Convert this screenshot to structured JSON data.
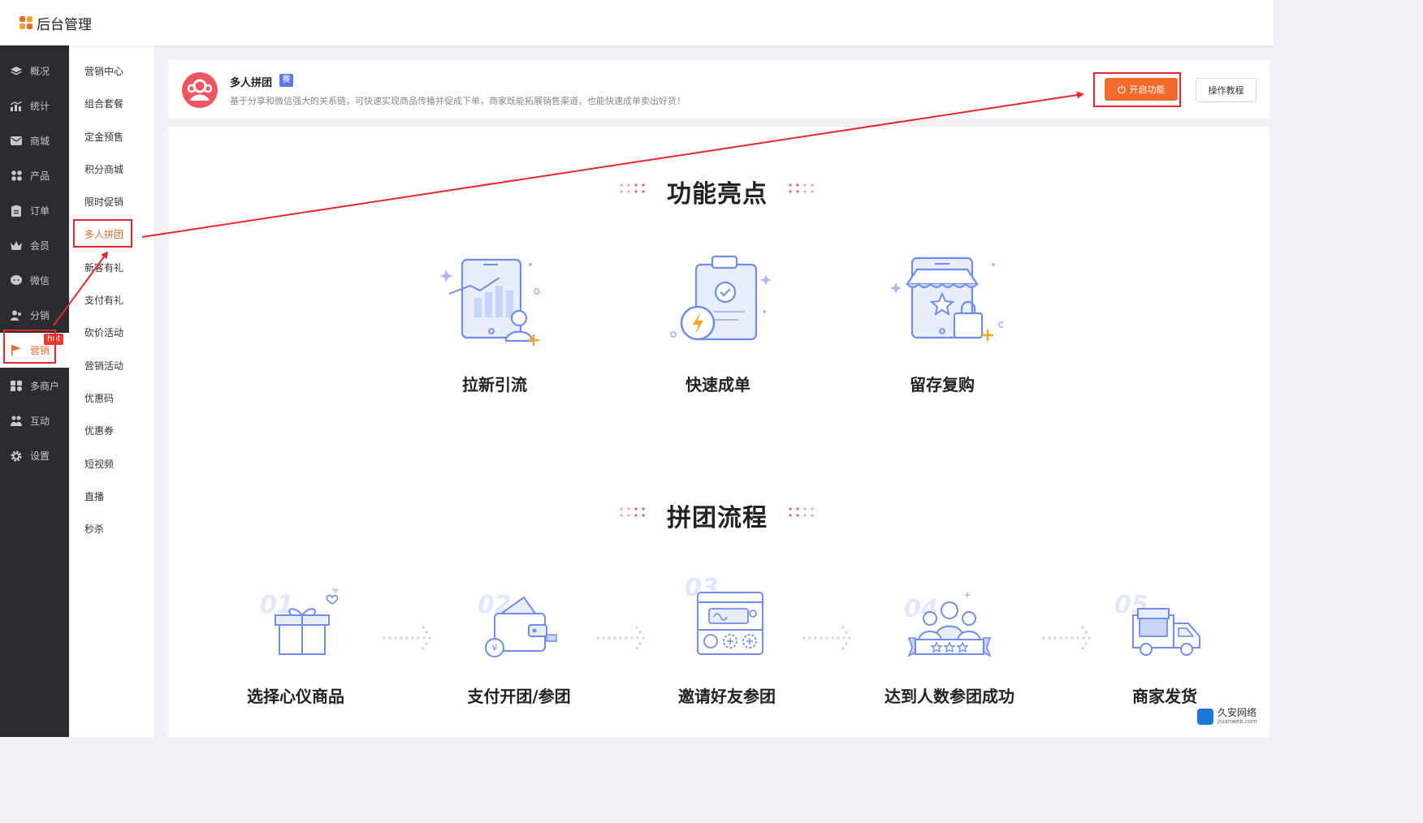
{
  "app": {
    "title": "后台管理"
  },
  "sidebar": {
    "items": [
      {
        "label": "概况",
        "icon": "layers-icon"
      },
      {
        "label": "统计",
        "icon": "stats-icon"
      },
      {
        "label": "商城",
        "icon": "mail-icon"
      },
      {
        "label": "产品",
        "icon": "product-icon"
      },
      {
        "label": "订单",
        "icon": "order-icon"
      },
      {
        "label": "会员",
        "icon": "crown-icon"
      },
      {
        "label": "微信",
        "icon": "chat-icon"
      },
      {
        "label": "分销",
        "icon": "users-icon"
      },
      {
        "label": "营销",
        "icon": "flag-icon",
        "badge": "hot",
        "active": true
      },
      {
        "label": "多商户",
        "icon": "store-icon"
      },
      {
        "label": "互动",
        "icon": "group-icon"
      },
      {
        "label": "设置",
        "icon": "gear-icon"
      }
    ]
  },
  "submenu": {
    "items": [
      "营销中心",
      "组合套餐",
      "定金预售",
      "积分商城",
      "限时促销",
      "多人拼团",
      "新客有礼",
      "支付有礼",
      "砍价活动",
      "营销活动",
      "优惠码",
      "优惠券",
      "短视频",
      "直播",
      "秒杀"
    ],
    "active": "多人拼团"
  },
  "feature": {
    "title": "多人拼团",
    "badge": "赛",
    "description": "基于分享和微信强大的关系链，可快速实现商品传播并促成下单，商家既能拓展销售渠道，也能快速成单卖出好货！",
    "open_button": "开启功能",
    "tutorial_button": "操作教程"
  },
  "highlights": {
    "title": "功能亮点",
    "items": [
      "拉新引流",
      "快速成单",
      "留存复购"
    ]
  },
  "process": {
    "title": "拼团流程",
    "steps": [
      {
        "num": "01",
        "label": "选择心仪商品"
      },
      {
        "num": "02",
        "label": "支付开团/参团"
      },
      {
        "num": "03",
        "label": "邀请好友参团"
      },
      {
        "num": "04",
        "label": "达到人数参团成功"
      },
      {
        "num": "05",
        "label": "商家发货"
      }
    ]
  },
  "watermark": {
    "name": "久安网络",
    "domain": "Jiuanweb.com"
  },
  "colors": {
    "accent": "#f26a2c",
    "sidebar_bg": "#2b2c2f",
    "annotation": "#e8262b",
    "icon_blue": "#6f8cf0",
    "badge_blue": "#5b77f5"
  }
}
